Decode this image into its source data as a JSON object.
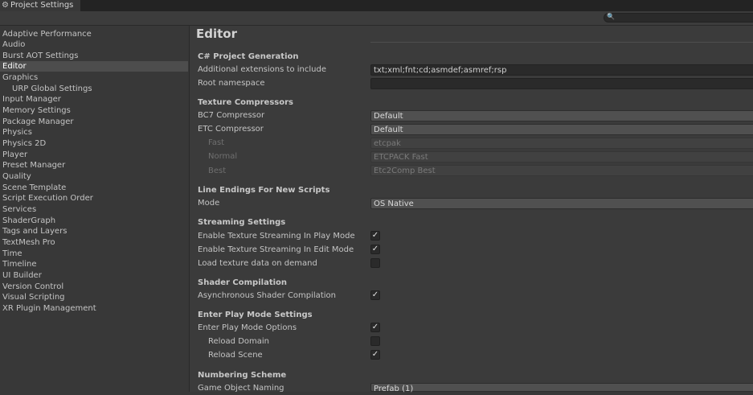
{
  "window": {
    "tab_title": "Project Settings",
    "tab_icon": "gear-icon"
  },
  "toolbar": {
    "search_placeholder": "",
    "search_icon": "search-icon"
  },
  "sidebar": {
    "selected": "Editor",
    "items": [
      {
        "label": "Adaptive Performance"
      },
      {
        "label": "Audio"
      },
      {
        "label": "Burst AOT Settings"
      },
      {
        "label": "Editor"
      },
      {
        "label": "Graphics"
      },
      {
        "label": "URP Global Settings"
      },
      {
        "label": "Input Manager"
      },
      {
        "label": "Memory Settings"
      },
      {
        "label": "Package Manager"
      },
      {
        "label": "Physics"
      },
      {
        "label": "Physics 2D"
      },
      {
        "label": "Player"
      },
      {
        "label": "Preset Manager"
      },
      {
        "label": "Quality"
      },
      {
        "label": "Scene Template"
      },
      {
        "label": "Script Execution Order"
      },
      {
        "label": "Services"
      },
      {
        "label": "ShaderGraph"
      },
      {
        "label": "Tags and Layers"
      },
      {
        "label": "TextMesh Pro"
      },
      {
        "label": "Time"
      },
      {
        "label": "Timeline"
      },
      {
        "label": "UI Builder"
      },
      {
        "label": "Version Control"
      },
      {
        "label": "Visual Scripting"
      },
      {
        "label": "XR Plugin Management"
      }
    ]
  },
  "main": {
    "title": "Editor",
    "csharp": {
      "header": "C# Project Generation",
      "extensions_label": "Additional extensions to include",
      "extensions_value": "txt;xml;fnt;cd;asmdef;asmref;rsp",
      "namespace_label": "Root namespace",
      "namespace_value": ""
    },
    "texture": {
      "header": "Texture Compressors",
      "bc7_label": "BC7 Compressor",
      "bc7_value": "Default",
      "etc_label": "ETC Compressor",
      "etc_value": "Default",
      "fast_label": "Fast",
      "fast_value": "etcpak",
      "normal_label": "Normal",
      "normal_value": "ETCPACK Fast",
      "best_label": "Best",
      "best_value": "Etc2Comp Best"
    },
    "line_endings": {
      "header": "Line Endings For New Scripts",
      "mode_label": "Mode",
      "mode_value": "OS Native"
    },
    "streaming": {
      "header": "Streaming Settings",
      "play_label": "Enable Texture Streaming In Play Mode",
      "play_checked": true,
      "edit_label": "Enable Texture Streaming In Edit Mode",
      "edit_checked": true,
      "demand_label": "Load texture data on demand",
      "demand_checked": false
    },
    "shader": {
      "header": "Shader Compilation",
      "async_label": "Asynchronous Shader Compilation",
      "async_checked": true
    },
    "play_mode": {
      "header": "Enter Play Mode Settings",
      "options_label": "Enter Play Mode Options",
      "options_checked": true,
      "reload_domain_label": "Reload Domain",
      "reload_domain_checked": false,
      "reload_scene_label": "Reload Scene",
      "reload_scene_checked": true
    },
    "numbering": {
      "header": "Numbering Scheme",
      "naming_label": "Game Object Naming",
      "naming_value": "Prefab (1)"
    }
  },
  "colors": {
    "highlight": "#e8f23a",
    "selected_row": "#4d4d4d",
    "background": "#383838"
  }
}
